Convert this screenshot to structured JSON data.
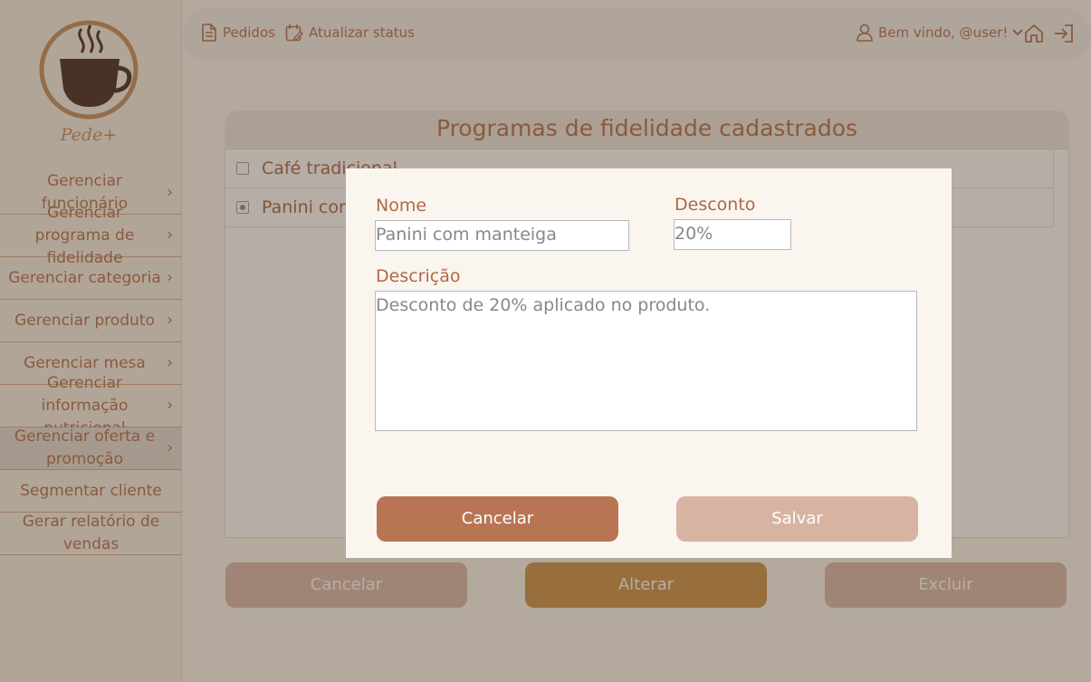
{
  "app": {
    "logo_text": "Pede+"
  },
  "sidebar": {
    "items": [
      {
        "label": "Gerenciar funcionário"
      },
      {
        "label": "Gerenciar programa de fidelidade"
      },
      {
        "label": "Gerenciar categoria"
      },
      {
        "label": "Gerenciar produto"
      },
      {
        "label": "Gerenciar mesa"
      },
      {
        "label": "Gerenciar informação nutricional"
      },
      {
        "label": "Gerenciar oferta e promoção"
      },
      {
        "label": "Segmentar cliente"
      },
      {
        "label": "Gerar relatório de vendas"
      }
    ]
  },
  "header": {
    "orders_label": "Pedidos",
    "update_status_label": "Atualizar status",
    "welcome_label": "Bem vindo, @user!"
  },
  "main": {
    "title": "Programas de fidelidade cadastrados",
    "rows": [
      {
        "label": "Café tradicional"
      },
      {
        "label": "Panini com manteiga"
      }
    ],
    "buttons": {
      "cancel": "Cancelar",
      "edit": "Alterar",
      "delete": "Excluir"
    }
  },
  "modal": {
    "name_label": "Nome",
    "name_value": "Panini com manteiga",
    "discount_label": "Desconto",
    "discount_value": "20%",
    "description_label": "Descrição",
    "description_value": "Desconto de 20% aplicado no produto.",
    "cancel_label": "Cancelar",
    "save_label": "Salvar"
  },
  "colors": {
    "accent": "#b06844",
    "primary_button": "#b87554",
    "secondary_button": "#d8b3a2",
    "edit_button": "#c98d3f",
    "disabled_button": "#d9b6a8"
  }
}
